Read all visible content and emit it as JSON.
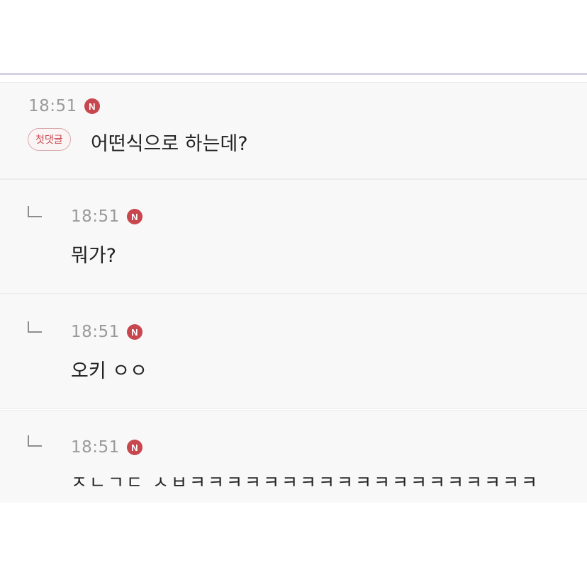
{
  "comments": [
    {
      "time": "18:51",
      "badge": "N",
      "label": "첫댓글",
      "text": "어떤식으로 하는데?"
    },
    {
      "time": "18:51",
      "badge": "N",
      "text": "뭐가?"
    },
    {
      "time": "18:51",
      "badge": "N",
      "text": "오키 ㅇㅇ"
    },
    {
      "time": "18:51",
      "badge": "N",
      "text": "ㅈㄴㄱㄷ ㅅㅂㅋㅋㅋㅋㅋㅋㅋㅋㅋㅋㅋㅋㅋㅋㅋㅋㅋㅋㅋ"
    }
  ],
  "colors": {
    "badge": "#c8474e",
    "time": "#9a9a9a",
    "text": "#222222",
    "divider": "#d4d2e2"
  }
}
